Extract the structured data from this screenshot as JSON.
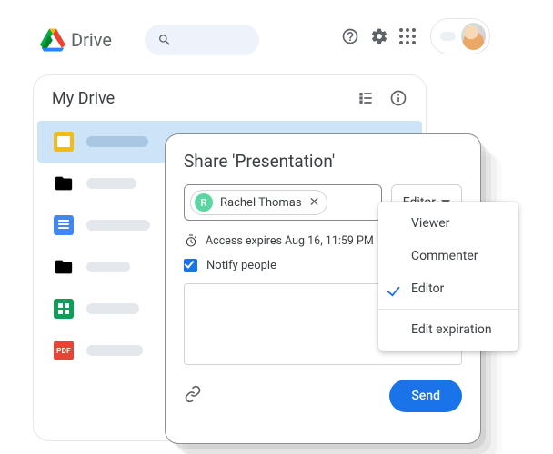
{
  "topbar": {
    "product_name": "Drive"
  },
  "drive": {
    "title": "My Drive"
  },
  "share": {
    "title": "Share 'Presentation'",
    "person": {
      "initial": "R",
      "name": "Rachel Thomas"
    },
    "role_button": "Editor",
    "access_expires": "Access expires Aug 16, 11:59 PM",
    "notify_label": "Notify people",
    "send_label": "Send"
  },
  "menu": {
    "viewer": "Viewer",
    "commenter": "Commenter",
    "editor": "Editor",
    "edit_expiration": "Edit expiration"
  }
}
